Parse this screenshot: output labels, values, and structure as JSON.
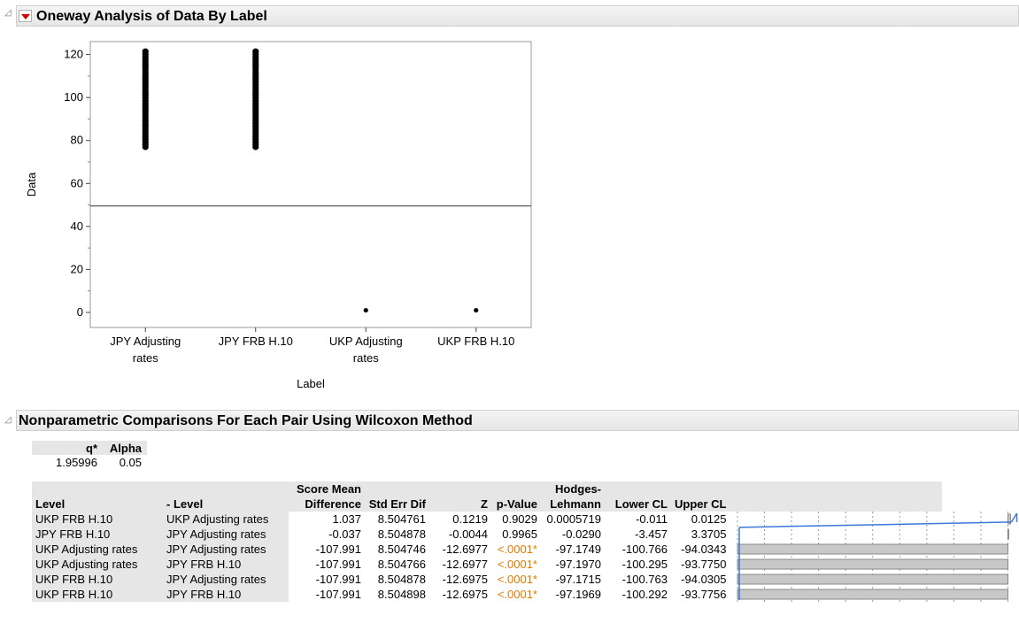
{
  "oneway": {
    "title": "Oneway Analysis of Data By Label"
  },
  "chart_data": {
    "type": "scatter",
    "xlabel": "Label",
    "ylabel": "Data",
    "ylim": [
      -7,
      126
    ],
    "yticks": [
      0,
      20,
      40,
      60,
      80,
      100,
      120
    ],
    "categories": [
      "JPY Adjusting rates",
      "JPY FRB H.10",
      "UKP Adjusting rates",
      "UKP FRB H.10"
    ],
    "category_label_lines": [
      [
        "JPY Adjusting",
        "rates"
      ],
      [
        "JPY FRB H.10"
      ],
      [
        "UKP Adjusting",
        "rates"
      ],
      [
        "UKP FRB H.10"
      ]
    ],
    "grand_mean": 49.5,
    "series": [
      {
        "category": "JPY Adjusting rates",
        "ymin": 77,
        "ymax": 122
      },
      {
        "category": "JPY FRB H.10",
        "ymin": 77,
        "ymax": 122
      },
      {
        "category": "UKP Adjusting rates",
        "values": [
          1
        ]
      },
      {
        "category": "UKP FRB H.10",
        "values": [
          1
        ]
      }
    ]
  },
  "nonparam": {
    "title": "Nonparametric Comparisons For Each Pair Using Wilcoxon Method",
    "q_header": "q*",
    "alpha_header": "Alpha",
    "q_value": "1.95996",
    "alpha_value": "0.05",
    "headers_top": {
      "score": "Score Mean",
      "hodges": "Hodges-"
    },
    "headers": {
      "level": "Level",
      "minus_level": "- Level",
      "score": "Difference",
      "stderr": "Std Err Dif",
      "z": "Z",
      "p": "p-Value",
      "hodges": "Lehmann",
      "lower": "Lower CL",
      "upper": "Upper CL"
    },
    "rows": [
      {
        "level": "UKP FRB H.10",
        "minus": "UKP Adjusting rates",
        "score": "1.037",
        "stderr": "8.504761",
        "z": "0.1219",
        "p": "0.9029",
        "sig": false,
        "hl": "0.0005719",
        "lower": "-0.011",
        "upper": "0.0125",
        "score_value": 1.037
      },
      {
        "level": "JPY FRB H.10",
        "minus": "JPY Adjusting rates",
        "score": "-0.037",
        "stderr": "8.504878",
        "z": "-0.0044",
        "p": "0.9965",
        "sig": false,
        "hl": "-0.0290",
        "lower": "-3.457",
        "upper": "3.3705",
        "score_value": -0.037
      },
      {
        "level": "UKP Adjusting rates",
        "minus": "JPY Adjusting rates",
        "score": "-107.991",
        "stderr": "8.504746",
        "z": "-12.6977",
        "p": "<.0001*",
        "sig": true,
        "hl": "-97.1749",
        "lower": "-100.766",
        "upper": "-94.0343",
        "score_value": -107.991
      },
      {
        "level": "UKP Adjusting rates",
        "minus": "JPY FRB H.10",
        "score": "-107.991",
        "stderr": "8.504766",
        "z": "-12.6977",
        "p": "<.0001*",
        "sig": true,
        "hl": "-97.1970",
        "lower": "-100.295",
        "upper": "-93.7750",
        "score_value": -107.991
      },
      {
        "level": "UKP FRB H.10",
        "minus": "JPY Adjusting rates",
        "score": "-107.991",
        "stderr": "8.504878",
        "z": "-12.6975",
        "p": "<.0001*",
        "sig": true,
        "hl": "-97.1715",
        "lower": "-100.763",
        "upper": "-94.0305",
        "score_value": -107.991
      },
      {
        "level": "UKP FRB H.10",
        "minus": "JPY FRB H.10",
        "score": "-107.991",
        "stderr": "8.504898",
        "z": "-12.6975",
        "p": "<.0001*",
        "sig": true,
        "hl": "-97.1969",
        "lower": "-100.292",
        "upper": "-93.7756",
        "score_value": -107.991
      }
    ]
  },
  "colors": {
    "significant": "#e07b00",
    "bar_fill": "#c8c8c8",
    "line": "#3c78d8",
    "disclosure": "#d40000"
  }
}
